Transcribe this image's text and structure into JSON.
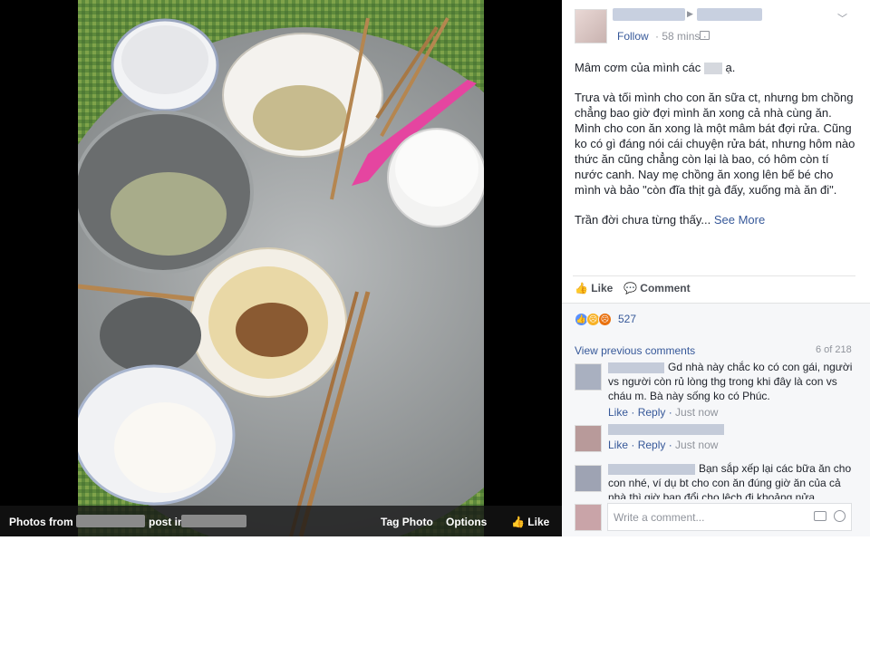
{
  "photo_bar": {
    "photos_from": "Photos from",
    "post_in": "post in",
    "tag_photo": "Tag Photo",
    "options": "Options",
    "like": "Like"
  },
  "post": {
    "follow": "Follow",
    "time": "58 mins",
    "text_line1_a": "Mâm cơm của mình các",
    "text_line1_b": "ạ.",
    "text_para2": "Trưa và tối mình cho con ăn sữa ct, nhưng bm chồng chẳng bao giờ đợi mình ăn xong cả nhà cùng ăn. Mình cho con ăn xong là một mâm bát đợi rửa. Cũng ko có gì đáng nói cái chuyện rửa bát, nhưng hôm nào thức ăn cũng chẳng còn lại là bao, có hôm còn tí nước canh. Nay mẹ chồng ăn xong lên bế bé cho mình và bảo \"còn đĩa thịt gà đấy, xuống mà ăn đi\".",
    "text_para3": "Trần đời chưa từng thấy...",
    "see_more": "See More"
  },
  "actions": {
    "like": "Like",
    "comment": "Comment"
  },
  "reactions": {
    "count": "527",
    "colors": {
      "like": "#5890ff",
      "sad": "#f7b125",
      "angry": "#e9710f"
    }
  },
  "comments": {
    "view_previous": "View previous comments",
    "count": "6 of 218",
    "items": [
      {
        "text": "Gd nhà này chắc ko có con gái, người vs người còn rủ lòng thg trong khi đây là con vs cháu m. Bà này sống ko có Phúc.",
        "like": "Like",
        "reply": "Reply",
        "time": "Just now"
      },
      {
        "text": "",
        "like": "Like",
        "reply": "Reply",
        "time": "Just now"
      },
      {
        "text": "Bạn sắp xếp lại các bữa ăn cho con nhé, ví dụ bt cho con ăn đúng giờ ăn của cả nhà thì giờ bạn đổi cho lệch đi khoảng nửa"
      }
    ],
    "input_placeholder": "Write a comment..."
  }
}
